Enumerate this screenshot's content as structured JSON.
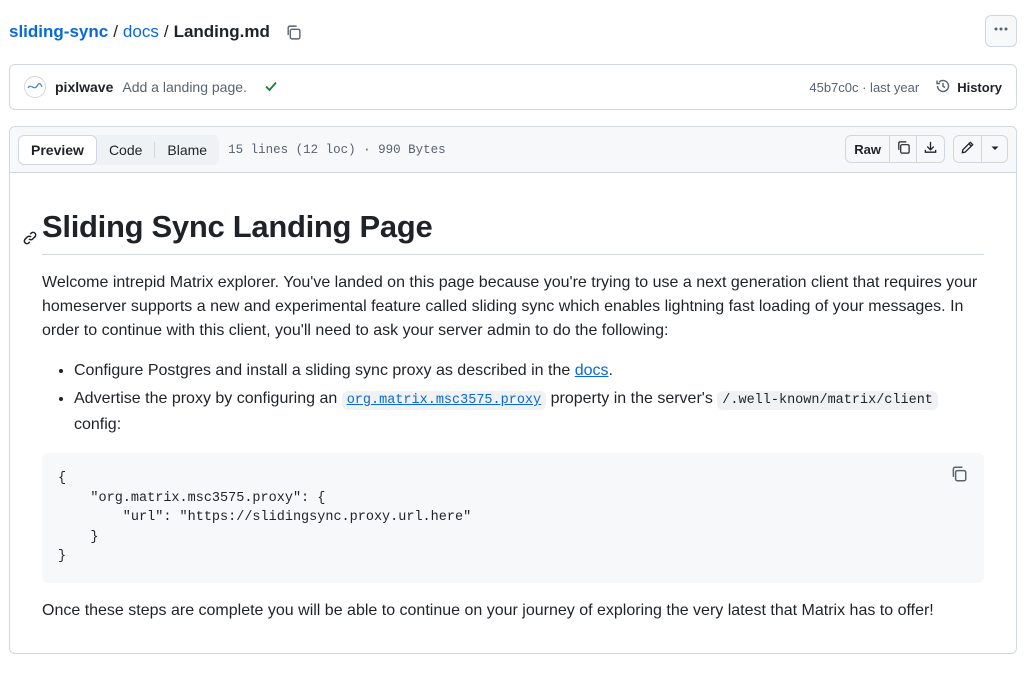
{
  "breadcrumb": {
    "repo": "sliding-sync",
    "dir": "docs",
    "file": "Landing.md",
    "sep": "/"
  },
  "commit": {
    "author": "pixlwave",
    "message": "Add a landing page.",
    "sha_time": "45b7c0c · last year",
    "history_label": "History"
  },
  "file_header": {
    "tabs": [
      "Preview",
      "Code",
      "Blame"
    ],
    "meta": "15 lines (12 loc) · 990 Bytes",
    "raw_label": "Raw"
  },
  "markdown": {
    "title": "Sliding Sync Landing Page",
    "intro": "Welcome intrepid Matrix explorer. You've landed on this page because you're trying to use a next generation client that requires your homeserver supports a new and experimental feature called sliding sync which enables lightning fast loading of your messages. In order to continue with this client, you'll need to ask your server admin to do the following:",
    "bullet1_pre": "Configure Postgres and install a sliding sync proxy as described in the ",
    "bullet1_link": "docs",
    "bullet1_post": ".",
    "bullet2_pre": "Advertise the proxy by configuring an ",
    "bullet2_code": "org.matrix.msc3575.proxy",
    "bullet2_mid": " property in the server's ",
    "bullet2_code2": "/.well-known/matrix/client",
    "bullet2_post": " config:",
    "code_block": "{\n    \"org.matrix.msc3575.proxy\": {\n        \"url\": \"https://slidingsync.proxy.url.here\"\n    }\n}",
    "outro": "Once these steps are complete you will be able to continue on your journey of exploring the very latest that Matrix has to offer!"
  },
  "colors": {
    "link": "#0969da",
    "border": "#d0d7de",
    "success": "#1a7f37"
  },
  "icons": [
    "copy-icon",
    "kebab-icon",
    "avatar-icon",
    "check-icon",
    "history-icon",
    "download-icon",
    "pencil-icon",
    "chevron-down-icon",
    "link-icon"
  ]
}
